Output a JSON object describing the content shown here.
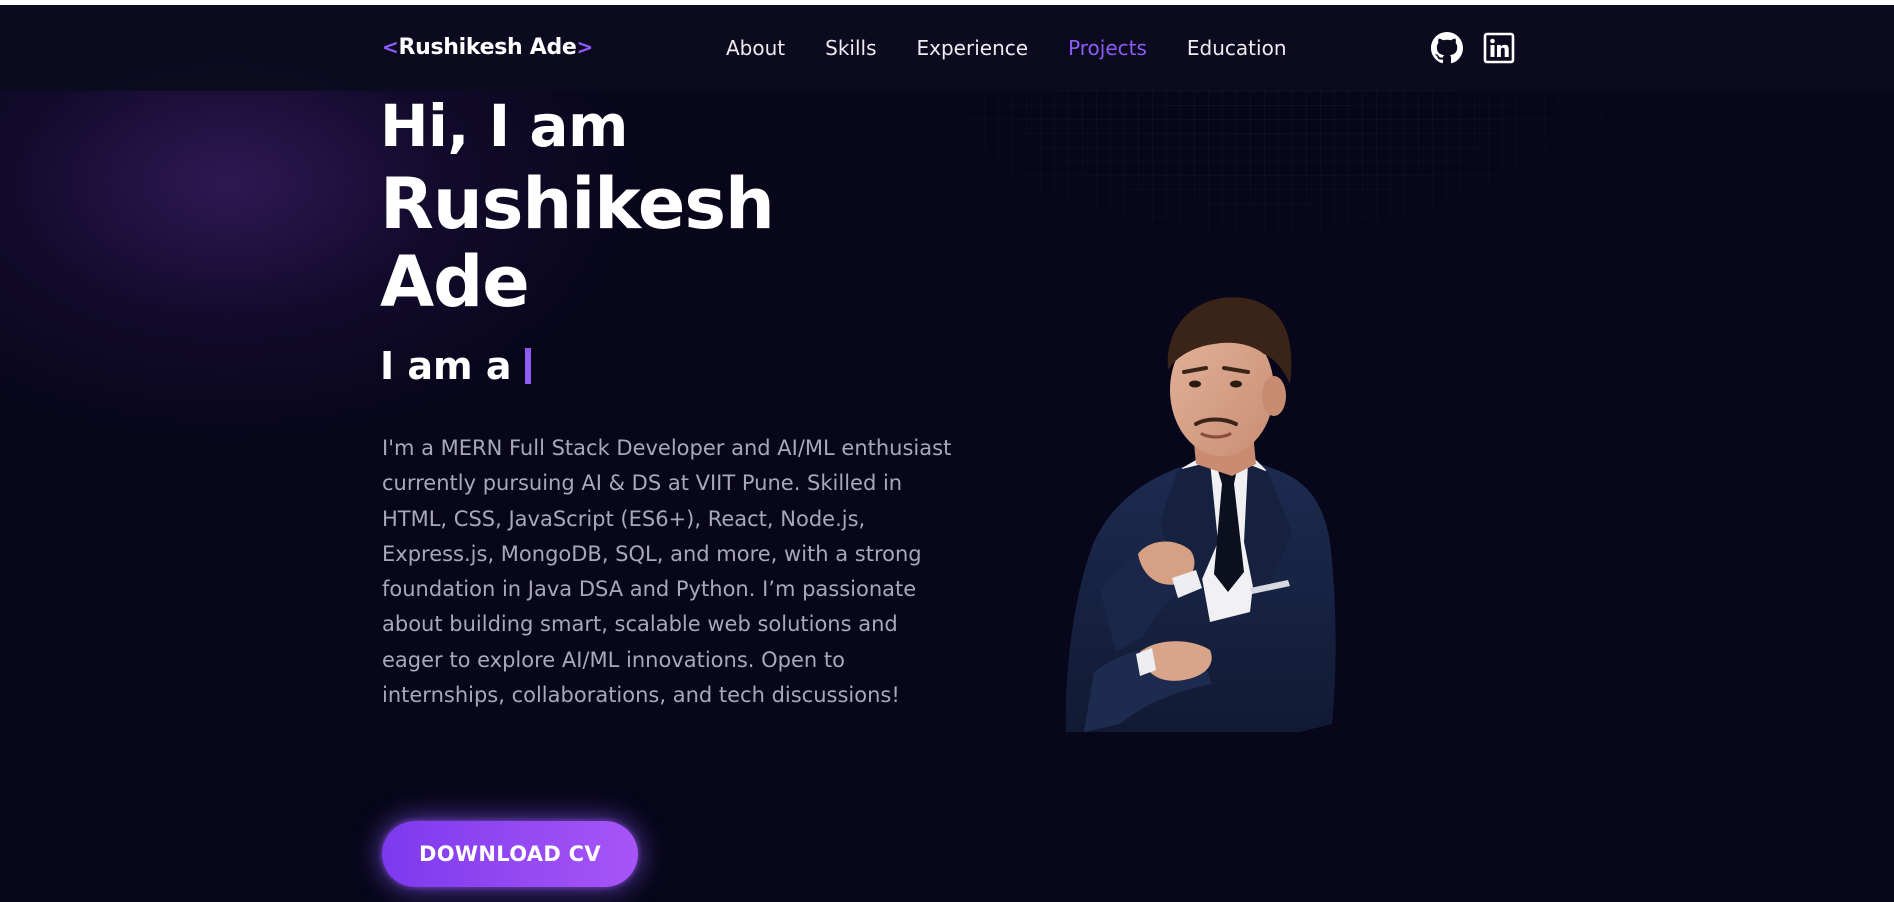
{
  "header": {
    "logo": {
      "open_bracket": "<",
      "name": "Rushikesh Ade",
      "close_bracket": ">"
    },
    "nav": [
      {
        "label": "About",
        "active": false
      },
      {
        "label": "Skills",
        "active": false
      },
      {
        "label": "Experience",
        "active": false
      },
      {
        "label": "Projects",
        "active": true
      },
      {
        "label": "Education",
        "active": false
      }
    ],
    "social_icons": [
      "github-icon",
      "linkedin-icon"
    ]
  },
  "hero": {
    "greeting": "Hi, I am",
    "name_line1": "Rushikesh",
    "name_line2": "Ade",
    "role_prefix": "I am a",
    "bio": "I'm a MERN Full Stack Developer and AI/ML enthusiast currently pursuing AI & DS at VIIT Pune. Skilled in HTML, CSS, JavaScript (ES6+), React, Node.js, Express.js, MongoDB, SQL, and more, with a strong foundation in Java DSA and Python. I’m passionate about building smart, scalable web solutions and eager to explore AI/ML innovations. Open to internships, collaborations, and tech discussions!",
    "cta_label": "DOWNLOAD CV"
  },
  "colors": {
    "background": "#07061a",
    "accent": "#8b5cf6",
    "text": "#ffffff",
    "muted_text": "#a9a8ba"
  }
}
